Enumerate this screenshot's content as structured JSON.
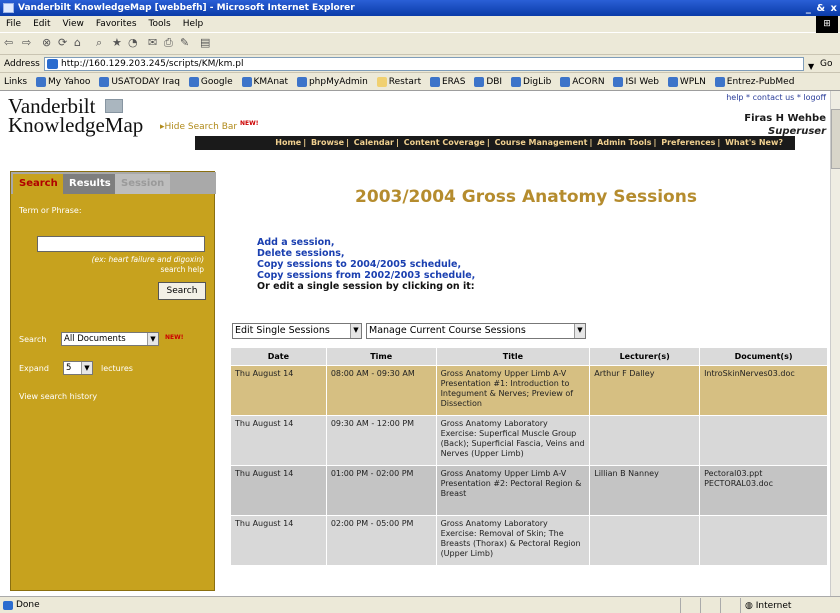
{
  "window": {
    "title": "Vanderbilt KnowledgeMap [webbefh] - Microsoft Internet Explorer",
    "controls": "_ & x"
  },
  "menu": [
    "File",
    "Edit",
    "View",
    "Favorites",
    "Tools",
    "Help"
  ],
  "address": {
    "label": "Address",
    "url": "http://160.129.203.245/scripts/KM/km.pl",
    "go": "Go"
  },
  "links": {
    "label": "Links",
    "items": [
      "My Yahoo",
      "USATODAY Iraq",
      "Google",
      "KMAnat",
      "phpMyAdmin",
      "Restart",
      "ERAS",
      "DBI",
      "DigLib",
      "ACORN",
      "ISI Web",
      "WPLN",
      "Entrez-PubMed"
    ]
  },
  "header": {
    "logo_line1": "Vanderbilt",
    "logo_line2": "KnowledgeMap",
    "hide_search": "Hide Search Bar",
    "new_badge": "NEW!",
    "top_links": "help * contact us * logoff",
    "user_name": "Firas H Wehbe",
    "user_role": "Superuser",
    "nav": [
      "Home",
      "Browse",
      "Calendar",
      "Content Coverage",
      "Course Management",
      "Admin Tools",
      "Preferences",
      "What's New?"
    ]
  },
  "sidebar": {
    "tabs": [
      "Search",
      "Results",
      "Session"
    ],
    "term_label": "Term or Phrase:",
    "term_value": "",
    "hint": "(ex: heart failure and digoxin)",
    "help": "search help",
    "search_btn": "Search",
    "search_label": "Search",
    "search_scope": "All Documents",
    "new_badge": "NEW!",
    "expand_label": "Expand",
    "expand_value": "5",
    "lectures_label": "lectures",
    "history": "View search history"
  },
  "page": {
    "title": "2003/2004 Gross Anatomy Sessions",
    "actions": [
      "Add a session,",
      "Delete sessions,",
      "Copy sessions to 2004/2005 schedule,",
      "Copy sessions from 2002/2003 schedule,"
    ],
    "actions_tail": "Or edit a single session by clicking on it:",
    "select1": "Edit Single Sessions",
    "select2": "Manage Current Course Sessions",
    "columns": [
      "Date",
      "Time",
      "Title",
      "Lecturer(s)",
      "Document(s)"
    ],
    "rows": [
      {
        "date": "Thu August 14",
        "time": "08:00 AM - 09:30 AM",
        "title": "Gross Anatomy Upper Limb A-V Presentation #1: Introduction to Integument & Nerves; Preview of Dissection",
        "lecturer": "Arthur F Dalley",
        "docs": "IntroSkinNerves03.doc"
      },
      {
        "date": "Thu August 14",
        "time": "09:30 AM - 12:00 PM",
        "title": "Gross Anatomy Laboratory Exercise: Superfical Muscle Group (Back); Superficial Fascia, Veins and Nerves (Upper Limb)",
        "lecturer": "",
        "docs": ""
      },
      {
        "date": "Thu August 14",
        "time": "01:00 PM - 02:00 PM",
        "title": "Gross Anatomy Upper Limb A-V Presentation #2: Pectoral Region & Breast",
        "lecturer": "Lillian B Nanney",
        "docs": "Pectoral03.ppt PECTORAL03.doc"
      },
      {
        "date": "Thu August 14",
        "time": "02:00 PM - 05:00 PM",
        "title": "Gross Anatomy Laboratory Exercise: Removal of Skin; The Breasts (Thorax) & Pectoral Region (Upper Limb)",
        "lecturer": "",
        "docs": ""
      }
    ]
  },
  "status": {
    "text": "Done",
    "zone": "Internet"
  }
}
